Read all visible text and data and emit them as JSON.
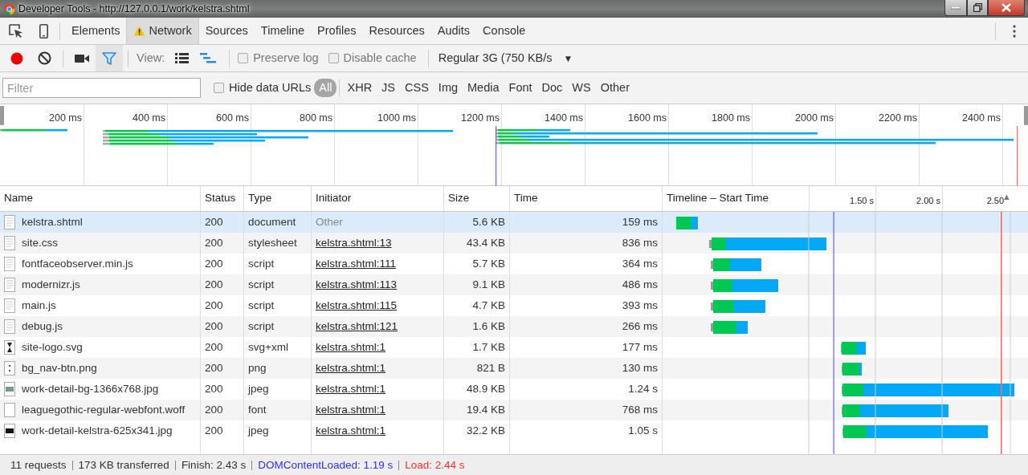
{
  "window": {
    "title": "Developer Tools - http://127.0.0.1/work/kelstra.shtml"
  },
  "panel_tabs": [
    {
      "label": "Elements",
      "selected": false,
      "warning": false
    },
    {
      "label": "Network",
      "selected": true,
      "warning": true
    },
    {
      "label": "Sources",
      "selected": false,
      "warning": false
    },
    {
      "label": "Timeline",
      "selected": false,
      "warning": false
    },
    {
      "label": "Profiles",
      "selected": false,
      "warning": false
    },
    {
      "label": "Resources",
      "selected": false,
      "warning": false
    },
    {
      "label": "Audits",
      "selected": false,
      "warning": false
    },
    {
      "label": "Console",
      "selected": false,
      "warning": false
    }
  ],
  "toolbar": {
    "recording": true,
    "filter_active": true,
    "view_label": "View:",
    "preserve_log": {
      "label": "Preserve log",
      "checked": false
    },
    "disable_cache": {
      "label": "Disable cache",
      "checked": false
    },
    "throttling": "Regular 3G (750 KB/s",
    "dropdown_arrow": "▼"
  },
  "filter_bar": {
    "placeholder": "Filter",
    "hide_data_urls": {
      "label": "Hide data URLs",
      "checked": false
    },
    "types": [
      {
        "label": "All",
        "selected": true
      },
      {
        "label": "XHR",
        "selected": false
      },
      {
        "label": "JS",
        "selected": false
      },
      {
        "label": "CSS",
        "selected": false
      },
      {
        "label": "Img",
        "selected": false
      },
      {
        "label": "Media",
        "selected": false
      },
      {
        "label": "Font",
        "selected": false
      },
      {
        "label": "Doc",
        "selected": false
      },
      {
        "label": "WS",
        "selected": false
      },
      {
        "label": "Other",
        "selected": false
      }
    ]
  },
  "overview": {
    "ticks": [
      "200 ms",
      "400 ms",
      "600 ms",
      "800 ms",
      "1000 ms",
      "1200 ms",
      "1400 ms",
      "1600 ms",
      "1800 ms",
      "2000 ms",
      "2200 ms",
      "2400 ms"
    ]
  },
  "table": {
    "columns": [
      "Name",
      "Status",
      "Type",
      "Initiator",
      "Size",
      "Time",
      "Timeline – Start Time"
    ],
    "timeline_ticks": [
      "1.50 s",
      "2.00 s",
      "2.50"
    ],
    "sort_indicator": "▲",
    "rows": [
      {
        "name": "kelstra.shtml",
        "status": "200",
        "type": "document",
        "initiator": "Other",
        "initiator_link": false,
        "size": "5.6 KB",
        "time": "159 ms",
        "selected": true,
        "kind": "document"
      },
      {
        "name": "site.css",
        "status": "200",
        "type": "stylesheet",
        "initiator": "kelstra.shtml:13",
        "initiator_link": true,
        "size": "43.4 KB",
        "time": "836 ms",
        "selected": false,
        "kind": "document"
      },
      {
        "name": "fontfaceobserver.min.js",
        "status": "200",
        "type": "script",
        "initiator": "kelstra.shtml:111",
        "initiator_link": true,
        "size": "5.7 KB",
        "time": "364 ms",
        "selected": false,
        "kind": "document"
      },
      {
        "name": "modernizr.js",
        "status": "200",
        "type": "script",
        "initiator": "kelstra.shtml:113",
        "initiator_link": true,
        "size": "9.1 KB",
        "time": "486 ms",
        "selected": false,
        "kind": "document"
      },
      {
        "name": "main.js",
        "status": "200",
        "type": "script",
        "initiator": "kelstra.shtml:115",
        "initiator_link": true,
        "size": "4.7 KB",
        "time": "393 ms",
        "selected": false,
        "kind": "document"
      },
      {
        "name": "debug.js",
        "status": "200",
        "type": "script",
        "initiator": "kelstra.shtml:121",
        "initiator_link": true,
        "size": "1.6 KB",
        "time": "266 ms",
        "selected": false,
        "kind": "document"
      },
      {
        "name": "site-logo.svg",
        "status": "200",
        "type": "svg+xml",
        "initiator": "kelstra.shtml:1",
        "initiator_link": true,
        "size": "1.7 KB",
        "time": "177 ms",
        "selected": false,
        "kind": "logo"
      },
      {
        "name": "bg_nav-btn.png",
        "status": "200",
        "type": "png",
        "initiator": "kelstra.shtml:1",
        "initiator_link": true,
        "size": "821 B",
        "time": "130 ms",
        "selected": false,
        "kind": "dots"
      },
      {
        "name": "work-detail-bg-1366x768.jpg",
        "status": "200",
        "type": "jpeg",
        "initiator": "kelstra.shtml:1",
        "initiator_link": true,
        "size": "48.9 KB",
        "time": "1.24 s",
        "selected": false,
        "kind": "photo"
      },
      {
        "name": "leaguegothic-regular-webfont.woff",
        "status": "200",
        "type": "font",
        "initiator": "kelstra.shtml:1",
        "initiator_link": true,
        "size": "19.4 KB",
        "time": "768 ms",
        "selected": false,
        "kind": "blank"
      },
      {
        "name": "work-detail-kelstra-625x341.jpg",
        "status": "200",
        "type": "jpeg",
        "initiator": "kelstra.shtml:1",
        "initiator_link": true,
        "size": "32.2 KB",
        "time": "1.05 s",
        "selected": false,
        "kind": "dark-photo"
      }
    ]
  },
  "status_bar": {
    "items": [
      {
        "text": "11 requests",
        "kind": "plain"
      },
      {
        "text": "173 KB transferred",
        "kind": "plain"
      },
      {
        "text": "Finish: 2.43 s",
        "kind": "plain"
      },
      {
        "text": "DOMContentLoaded: 1.19 s",
        "kind": "dom"
      },
      {
        "text": "Load: 2.44 s",
        "kind": "load"
      }
    ]
  }
}
